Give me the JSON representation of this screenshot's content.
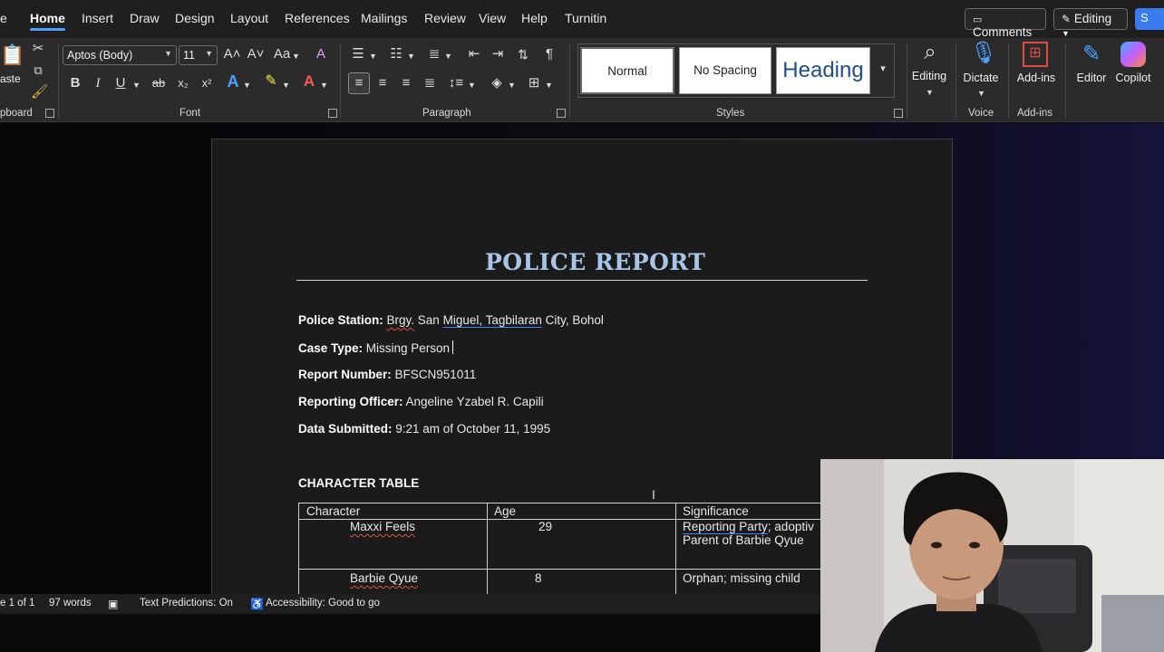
{
  "ribbon_tabs": [
    "e",
    "Home",
    "Insert",
    "Draw",
    "Design",
    "Layout",
    "References",
    "Mailings",
    "Review",
    "View",
    "Help",
    "Turnitin"
  ],
  "top_buttons": {
    "comments": "Comments",
    "editing": "Editing",
    "share": "S"
  },
  "ribbon": {
    "font_name": "Aptos (Body)",
    "font_size": "11",
    "clipboard_label": "pboard",
    "paste_label": "aste",
    "font_label": "Font",
    "paragraph_label": "Paragraph",
    "styles_label": "Styles",
    "styles": [
      "Normal",
      "No Spacing",
      "Heading"
    ],
    "editing_label": "Editing",
    "dictate_label": "Dictate",
    "voice_label": "Voice",
    "addins_label": "Add-ins",
    "addins_group_label": "Add-ins",
    "editor_label": "Editor",
    "copilot_label": "Copilot",
    "icons": {
      "bold": "B",
      "italic": "I",
      "underline": "U",
      "strike": "ab",
      "subscript": "x₂",
      "superscript": "x²",
      "grow": "A˄",
      "shrink": "A˅",
      "case": "Aa",
      "clear": "A",
      "pilcrow": "¶"
    }
  },
  "document": {
    "title": "POLICE REPORT",
    "fields": [
      {
        "label": "Police Station:",
        "value_parts": [
          "Brgy.",
          " San ",
          "Miguel,  Tagbilaran",
          " City, Bohol"
        ]
      },
      {
        "label": "Case Type:",
        "value": " Missing Person"
      },
      {
        "label": "Report Number:",
        "value": " BFSCN951011"
      },
      {
        "label": "Reporting Officer:",
        "value": " Angeline Yzabel R. Capili"
      },
      {
        "label": "Data Submitted:",
        "value": " 9:21 am of October 11, 1995"
      }
    ],
    "section_heading": "CHARACTER TABLE",
    "table": {
      "headers": [
        "Character",
        "Age",
        "Significance"
      ],
      "rows": [
        {
          "character": "Maxxi Feels",
          "age": "29",
          "significance_1": "Reporting  Party",
          "significance_2": "; adoptiv",
          "significance_3": "Parent of Barbie Qyue"
        },
        {
          "character": "Barbie Qyue",
          "age": "8",
          "significance_1": "Orphan; missing child",
          "significance_2": "",
          "significance_3": ""
        }
      ]
    }
  },
  "status_bar": {
    "page": "e 1 of 1",
    "words": "97 words",
    "text_predictions": "Text Predictions: On",
    "accessibility": "Accessibility: Good to go"
  },
  "colors": {
    "title": "#a9c6e8",
    "accent": "#4aa0ff",
    "share": "#3a7cf0"
  }
}
